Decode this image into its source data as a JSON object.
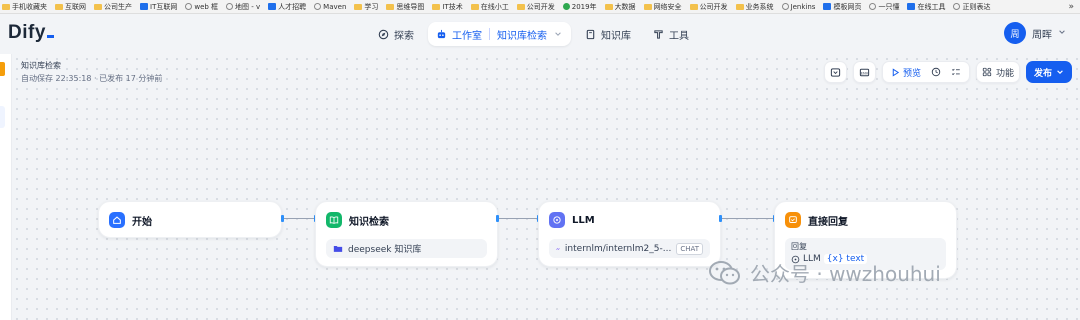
{
  "bookmarks": [
    "手机收藏夹",
    "互联网",
    "公司生产",
    "IT互联网",
    "web 框",
    "地图 - v",
    "人才招聘",
    "Maven",
    "学习",
    "思维导图",
    "IT技术",
    "在线小工",
    "公司开发",
    "2019年",
    "大数据",
    "网络安全",
    "公司开发",
    "业务系统",
    "Jenkins",
    "模板网页",
    "一只懂",
    "在线工具",
    "正则表达"
  ],
  "bookmarks_more": "»",
  "app": {
    "logo": "Dify"
  },
  "nav": {
    "explore": "探索",
    "studio": "工作室",
    "current_app": "知识库检索",
    "knowledge": "知识库",
    "tools": "工具"
  },
  "user": {
    "avatar_text": "周",
    "name": "周晖"
  },
  "app_info": {
    "name": "知识库检索",
    "autosave": "自动保存 22:35:18",
    "published": "已发布 17 分钟前"
  },
  "toolbar": {
    "preview": "预览",
    "features": "功能",
    "publish": "发布"
  },
  "nodes": {
    "start": {
      "title": "开始"
    },
    "knowledge": {
      "title": "知识检索",
      "field": "deepseek 知识库"
    },
    "llm": {
      "title": "LLM",
      "field": "internlm/internlm2_5-...",
      "badge": "CHAT"
    },
    "answer": {
      "title": "直接回复",
      "label": "回复",
      "var_node": "LLM",
      "var_name": "{x} text"
    }
  },
  "watermark": {
    "text": "公众号 · wwzhouhui"
  },
  "colors": {
    "primary": "#155eef",
    "start": "#2970ff",
    "knowledge": "#12b76a",
    "llm": "#6172f3",
    "answer": "#f79009"
  },
  "icons": [
    "compass-icon",
    "robot-icon",
    "book-icon",
    "tool-icon",
    "chevron-down-icon",
    "play-icon",
    "history-icon",
    "checklist-icon",
    "grid-icon",
    "home-icon",
    "folder-icon",
    "brain-icon",
    "reply-icon"
  ]
}
